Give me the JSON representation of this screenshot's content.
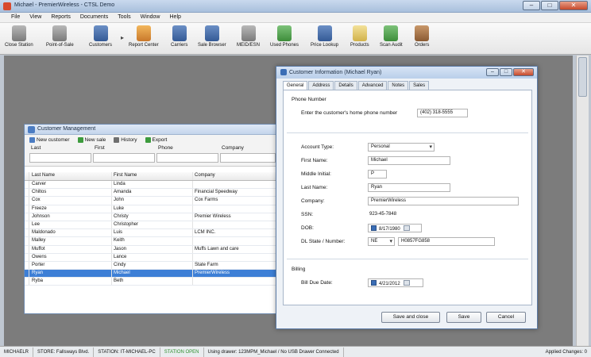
{
  "window": {
    "title": "Michael - PremierWireless - CTSL Demo"
  },
  "menu": [
    "File",
    "View",
    "Reports",
    "Documents",
    "Tools",
    "Window",
    "Help"
  ],
  "toolbar": [
    {
      "label": "Close Station",
      "icon": "close-station-icon"
    },
    {
      "label": "Point-of-Sale",
      "icon": "shopping-cart-icon"
    },
    {
      "label": "Customers",
      "icon": "customers-icon"
    },
    {
      "label": "Report Center",
      "icon": "report-chart-icon"
    },
    {
      "label": "Carriers",
      "icon": "carrier-tower-icon"
    },
    {
      "label": "Sale Browser",
      "icon": "magnifier-icon"
    },
    {
      "label": "MEID/ESN",
      "icon": "phone-icon"
    },
    {
      "label": "Used Phones",
      "icon": "recycle-icon"
    },
    {
      "label": "Price Lookup",
      "icon": "price-lookup-icon"
    },
    {
      "label": "Products",
      "icon": "products-icon"
    },
    {
      "label": "Scan Audit",
      "icon": "scan-audit-icon"
    },
    {
      "label": "Orders",
      "icon": "orders-boxes-icon"
    }
  ],
  "customer_management": {
    "title": "Customer Management",
    "tools": [
      "New customer",
      "New sale",
      "History",
      "Export"
    ],
    "filters": [
      "Last",
      "First",
      "Phone",
      "Company"
    ],
    "columns": [
      "Last Name",
      "First Name",
      "Company"
    ],
    "rows": [
      [
        "Carver",
        "Linda",
        ""
      ],
      [
        "Chiltos",
        "Amanda",
        "Financial Speedway"
      ],
      [
        "Cox",
        "John",
        "Cox Farms"
      ],
      [
        "Freeze",
        "Luke",
        ""
      ],
      [
        "Johnson",
        "Christy",
        "Premier Wireless"
      ],
      [
        "Lee",
        "Christopher",
        ""
      ],
      [
        "Maldonado",
        "Luis",
        "LCM INC."
      ],
      [
        "Malley",
        "Keith",
        ""
      ],
      [
        "Muffot",
        "Jason",
        "Muffs Lawn and care"
      ],
      [
        "Owens",
        "Lance",
        ""
      ],
      [
        "Porter",
        "Cindy",
        "State Farm"
      ],
      [
        "Ryan",
        "Michael",
        "PremierWireless"
      ],
      [
        "Ryba",
        "Beth",
        ""
      ]
    ],
    "selected_row": 11
  },
  "customer_information": {
    "title": "Customer Information (Michael Ryan)",
    "tabs": [
      "General",
      "Address",
      "Details",
      "Advanced",
      "Notes",
      "Sales"
    ],
    "active_tab": "General",
    "phone_section": "Phone Number",
    "phone_prompt": "Enter the customer's home phone number",
    "phone_value": "(402) 318-5555",
    "fields": {
      "account_type": {
        "label": "Account Type:",
        "value": "Personal"
      },
      "first_name": {
        "label": "First Name:",
        "value": "Michael"
      },
      "middle_initial": {
        "label": "Middle Initial:",
        "value": "P"
      },
      "last_name": {
        "label": "Last Name:",
        "value": "Ryan"
      },
      "company": {
        "label": "Company:",
        "value": "PremierWireless"
      },
      "ssn": {
        "label": "SSN:",
        "value": "923-45-7848"
      },
      "dob": {
        "label": "DOB:",
        "value": "8/17/1980"
      },
      "dl": {
        "label": "DL State / Number:",
        "state": "NE",
        "number": "H0857FG858"
      }
    },
    "billing_section": "Billing",
    "bill_due": {
      "label": "Bill Due Date:",
      "value": "4/21/2012"
    },
    "buttons": {
      "save_close": "Save and close",
      "save": "Save",
      "cancel": "Cancel"
    }
  },
  "status_bar": {
    "user": "MICHAELR",
    "store": "STORE: Fallsways Blvd.",
    "station": "STATION: IT-MICHAEL-PC",
    "station_state": "STATION OPEN",
    "drawer": "Using drawer: 123MPM_Michael / No USB Drawer Connected",
    "changes": "Applied Changes: 0"
  }
}
